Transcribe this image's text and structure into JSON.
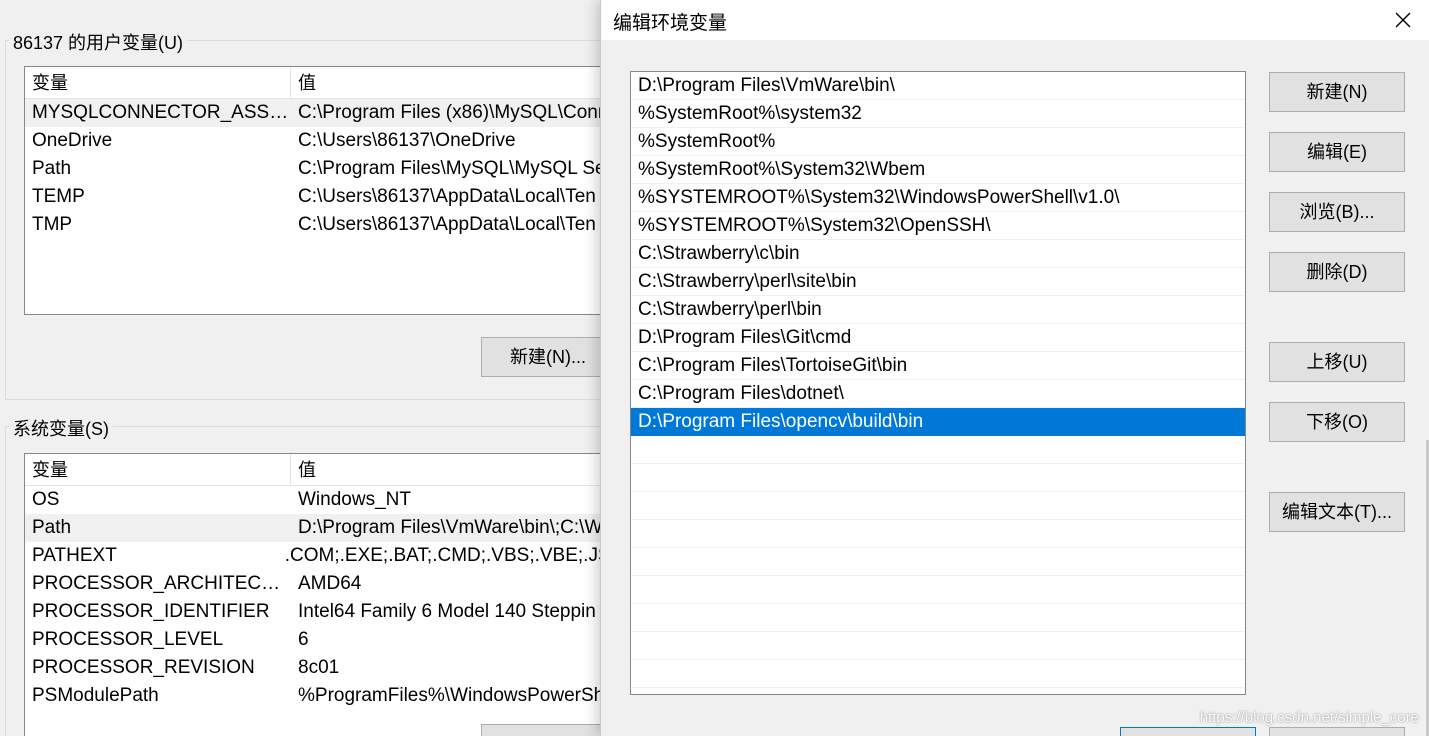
{
  "background": {
    "user_vars": {
      "label": "86137 的用户变量(U)",
      "columns": [
        "变量",
        "值"
      ],
      "rows": [
        {
          "name": "MYSQLCONNECTOR_ASSE...",
          "value": "C:\\Program Files (x86)\\MySQL\\Conn"
        },
        {
          "name": "OneDrive",
          "value": "C:\\Users\\86137\\OneDrive"
        },
        {
          "name": "Path",
          "value": "C:\\Program Files\\MySQL\\MySQL Se"
        },
        {
          "name": "TEMP",
          "value": "C:\\Users\\86137\\AppData\\Local\\Ten"
        },
        {
          "name": "TMP",
          "value": "C:\\Users\\86137\\AppData\\Local\\Ten"
        }
      ],
      "new_button": "新建(N)..."
    },
    "sys_vars": {
      "label": "系统变量(S)",
      "columns": [
        "变量",
        "值"
      ],
      "rows": [
        {
          "name": "OS",
          "value": "Windows_NT"
        },
        {
          "name": "Path",
          "value": "D:\\Program Files\\VmWare\\bin\\;C:\\W"
        },
        {
          "name": "PATHEXT",
          "value": ".COM;.EXE;.BAT;.CMD;.VBS;.VBE;.JS;.J"
        },
        {
          "name": "PROCESSOR_ARCHITECTURE",
          "value": "AMD64"
        },
        {
          "name": "PROCESSOR_IDENTIFIER",
          "value": "Intel64 Family 6 Model 140 Steppin"
        },
        {
          "name": "PROCESSOR_LEVEL",
          "value": "6"
        },
        {
          "name": "PROCESSOR_REVISION",
          "value": "8c01"
        },
        {
          "name": "PSModulePath",
          "value": "%ProgramFiles%\\WindowsPowerSh"
        }
      ]
    }
  },
  "dialog": {
    "title": "编辑环境变量",
    "paths": [
      "D:\\Program Files\\VmWare\\bin\\",
      "%SystemRoot%\\system32",
      "%SystemRoot%",
      "%SystemRoot%\\System32\\Wbem",
      "%SYSTEMROOT%\\System32\\WindowsPowerShell\\v1.0\\",
      "%SYSTEMROOT%\\System32\\OpenSSH\\",
      "C:\\Strawberry\\c\\bin",
      "C:\\Strawberry\\perl\\site\\bin",
      "C:\\Strawberry\\perl\\bin",
      "D:\\Program Files\\Git\\cmd",
      "C:\\Program Files\\TortoiseGit\\bin",
      "C:\\Program Files\\dotnet\\",
      "D:\\Program Files\\opencv\\build\\bin"
    ],
    "selected_index": 12,
    "buttons": {
      "new": "新建(N)",
      "edit": "编辑(E)",
      "browse": "浏览(B)...",
      "delete": "删除(D)",
      "move_up": "上移(U)",
      "move_down": "下移(O)",
      "edit_text": "编辑文本(T)..."
    }
  },
  "watermark": "https://blog.csdn.net/simple_core",
  "colors": {
    "selection": "#0078d7",
    "window_bg": "#f0f0f0"
  }
}
